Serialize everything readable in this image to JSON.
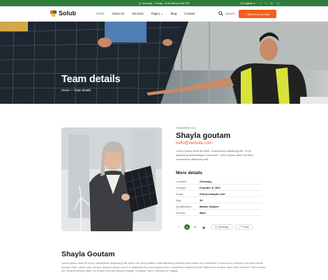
{
  "topbar": {
    "hours": "Monday - Friday : 8:30 AM to 8:30 PM",
    "language": "English",
    "social_icons": [
      "facebook-icon",
      "twitter-icon",
      "linkedin-icon",
      "instagram-icon"
    ]
  },
  "nav": {
    "logo": "Solub",
    "items": [
      "Home",
      "About Us",
      "Services",
      "Pages",
      "Blog",
      "Contact"
    ],
    "search_label": "Search",
    "cta": "+ 888 1234 444488"
  },
  "hero": {
    "title": "Team details",
    "breadcrumb": "Home  —  Team details"
  },
  "profile": {
    "role": "FOUNDER CO",
    "name": "Shayla goutam",
    "email": "hello@website.com",
    "bio": "Lorem ipsum dolor sit amet, consectetur adipiscing elit. Proin adipiscing pellentesque commodo. Lorem ipsum dolor sit amet consectetur adipiscing elit.",
    "more_title": "More details",
    "details": [
      {
        "k": "Location:",
        "v": "Germany"
      },
      {
        "k": "Position:",
        "v": "Founder & CEO"
      },
      {
        "k": "Email:",
        "v": "info@example.com"
      },
      {
        "k": "Age:",
        "v": "34"
      },
      {
        "k": "Qualification:",
        "v": "Master Degree"
      },
      {
        "k": "Gender:",
        "v": "Male"
      }
    ],
    "social": [
      "f",
      "✕",
      "in",
      "▣"
    ],
    "message_label": "Message",
    "share_label": "Share"
  },
  "about": {
    "heading": "Shayla Goutam",
    "paragraph": "Lorem ipsum dolor sit amet, consectetur adipiscing elit. Morbi elit urna porttitor vitae adipiscing eleifend sed mauris id consectetur in cursus ac hendrerit. Aenean mauris suscipit vitae rutrum odio, tempor aliquam donec sed et et dignissim et porta mauris tortor. Consectetur adipiscing elit. Maecenas semper diam odio id ipsum. Sed et tortor elit, sit amet tempor diam. Ut at ante sed nisi tempus feugiat. Curabitur nisi in. Aenean eu magna."
  },
  "colors": {
    "green": "#2e7d3b",
    "orange": "#f2601c"
  }
}
